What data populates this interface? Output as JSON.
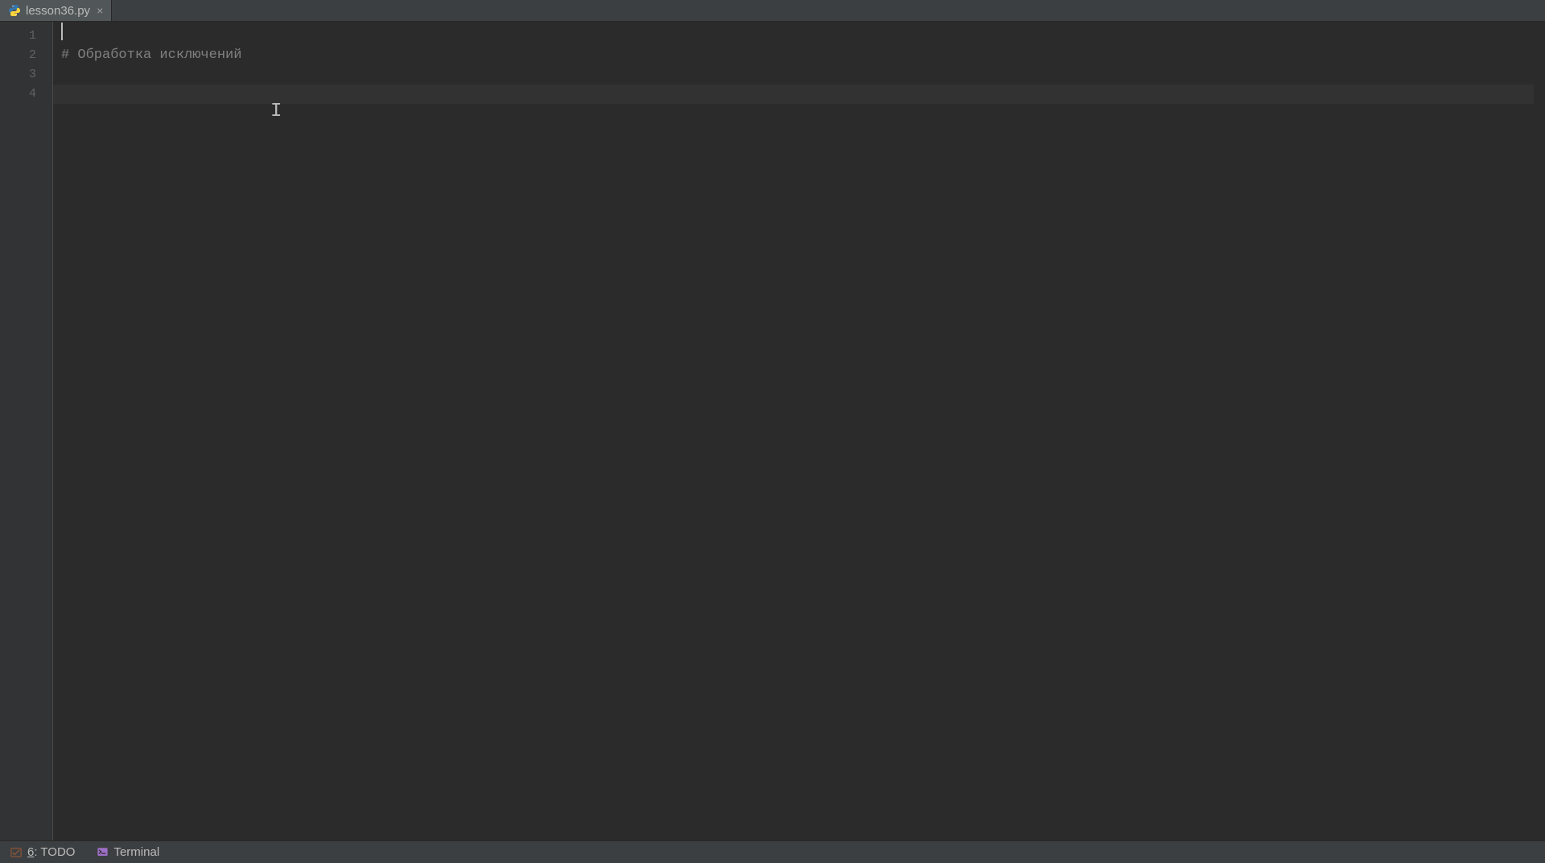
{
  "tabs": [
    {
      "label": "lesson36.py",
      "active": true
    }
  ],
  "editor": {
    "lines": [
      {
        "n": "1",
        "text": "",
        "kind": "blank"
      },
      {
        "n": "2",
        "text": "# Обработка исключений",
        "kind": "comment"
      },
      {
        "n": "3",
        "text": "",
        "kind": "blank"
      },
      {
        "n": "4",
        "text": "",
        "kind": "blank",
        "current": true
      }
    ],
    "caret_line": 4
  },
  "bottom": {
    "todo": {
      "hotkey": "6",
      "label": ": TODO"
    },
    "terminal": {
      "label": "Terminal"
    }
  }
}
